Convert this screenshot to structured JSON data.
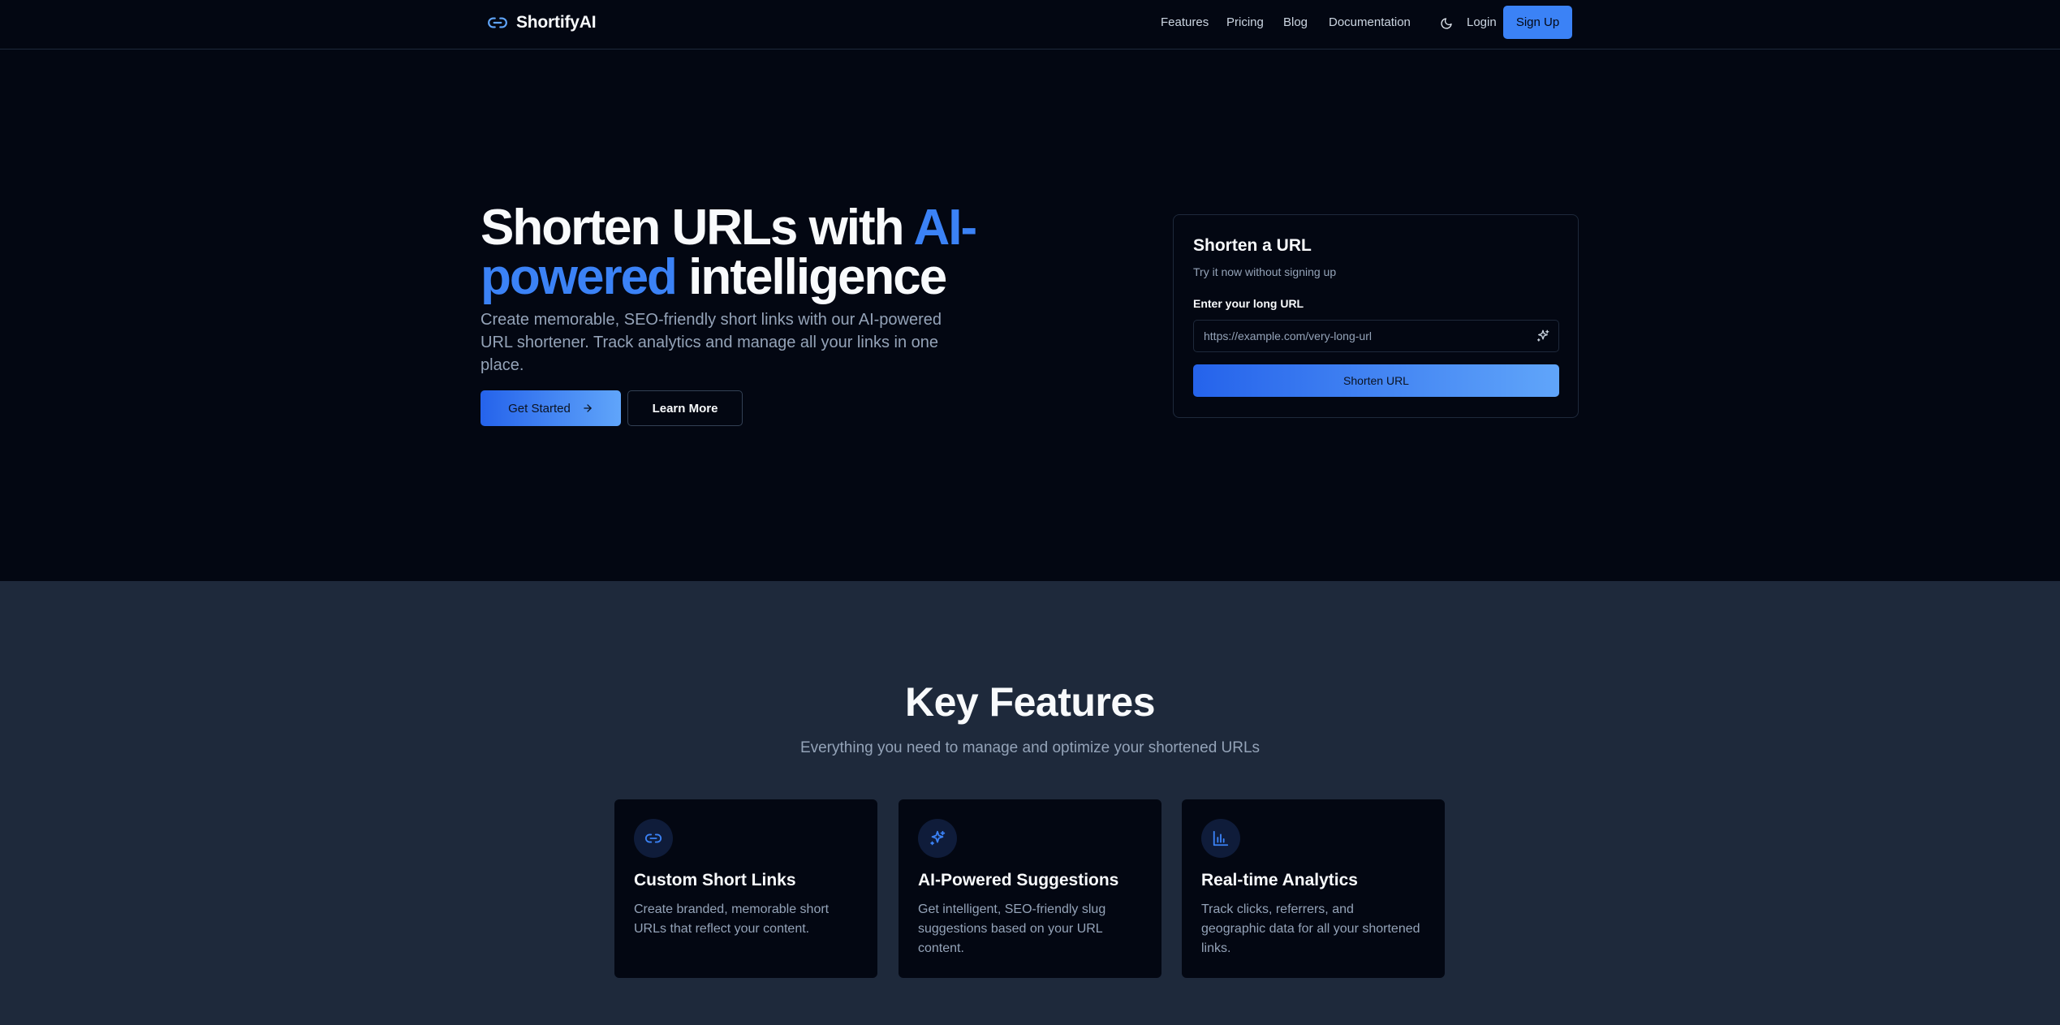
{
  "brand": {
    "name": "ShortifyAI",
    "icon": "link-icon"
  },
  "nav": {
    "links": [
      "Features",
      "Pricing",
      "Blog",
      "Documentation"
    ],
    "theme_icon": "moon-icon",
    "login_label": "Login",
    "signup_label": "Sign Up"
  },
  "hero": {
    "title_part1": "Shorten URLs with ",
    "title_accent": "AI-powered",
    "title_part2": " intelligence",
    "subtitle": "Create memorable, SEO-friendly short links with our AI-powered URL shortener. Track analytics and manage all your links in one place.",
    "primary_cta": "Get Started",
    "primary_cta_icon": "arrow-right-icon",
    "secondary_cta": "Learn More"
  },
  "shorten_card": {
    "title": "Shorten a URL",
    "subtitle": "Try it now without signing up",
    "field_label": "Enter your long URL",
    "input_placeholder": "https://example.com/very-long-url",
    "input_icon": "sparkles-icon",
    "submit_label": "Shorten URL"
  },
  "features": {
    "title": "Key Features",
    "subtitle": "Everything you need to manage and optimize your shortened URLs",
    "items": [
      {
        "icon": "link-icon",
        "title": "Custom Short Links",
        "description": "Create branded, memorable short URLs that reflect your content."
      },
      {
        "icon": "sparkles-icon",
        "title": "AI-Powered Suggestions",
        "description": "Get intelligent, SEO-friendly slug suggestions based on your URL content."
      },
      {
        "icon": "bar-chart-icon",
        "title": "Real-time Analytics",
        "description": "Track clicks, referrers, and geographic data for all your shortened links."
      }
    ]
  },
  "colors": {
    "background": "#030712",
    "section_alt": "#1e293b",
    "accent": "#3b82f6",
    "text_primary": "#f8fafc",
    "text_muted": "#94a3b8"
  }
}
